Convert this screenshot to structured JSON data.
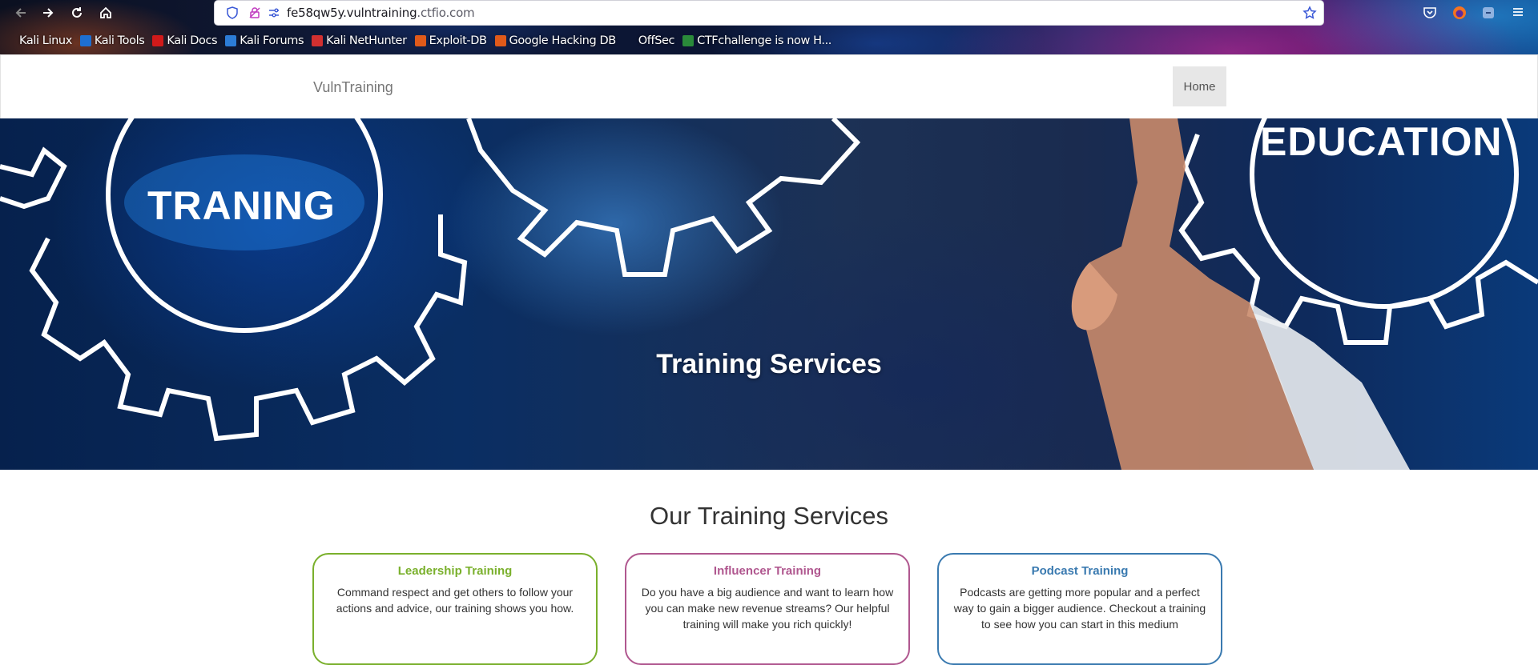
{
  "browser": {
    "url_host": "fe58qw5y.vulntraining",
    "url_tld": ".ctfio.com",
    "bookmarks": [
      {
        "label": "Kali Linux",
        "color": ""
      },
      {
        "label": "Kali Tools",
        "color": "#1e6fd1"
      },
      {
        "label": "Kali Docs",
        "color": "#d11a1a"
      },
      {
        "label": "Kali Forums",
        "color": "#2c7cd6"
      },
      {
        "label": "Kali NetHunter",
        "color": "#d23030"
      },
      {
        "label": "Exploit-DB",
        "color": "#e05a1a"
      },
      {
        "label": "Google Hacking DB",
        "color": "#e05a1a"
      },
      {
        "label": "OffSec",
        "color": ""
      },
      {
        "label": "CTFchallenge is now H...",
        "color": "#2a8a3a"
      }
    ],
    "icons": [
      "back-arrow-icon",
      "forward-arrow-icon",
      "reload-icon",
      "home-icon",
      "shield-icon",
      "permissions-icon",
      "site-info-icon",
      "bookmark-star-icon",
      "pocket-icon",
      "firefox-account-icon",
      "extensions-icon",
      "menu-icon"
    ]
  },
  "site": {
    "brand": "VulnTraining",
    "nav": {
      "home": "Home"
    }
  },
  "hero": {
    "title": "Training Services",
    "gear_left_text": "TRANING",
    "gear_right_text": "EDUCATION"
  },
  "services": {
    "heading": "Our Training Services",
    "cards": [
      {
        "title": "Leadership Training",
        "text": "Command respect and get others to follow your actions and advice, our training shows you how.",
        "color": "#7ab02c"
      },
      {
        "title": "Influencer Training",
        "text": "Do you have a big audience and want to learn how you can make new revenue streams? Our helpful training will make you rich quickly!",
        "color": "#b0578f"
      },
      {
        "title": "Podcast Training",
        "text": "Podcasts are getting more popular and a perfect way to gain a bigger audience. Checkout a training to see how you can start in this medium",
        "color": "#3a7ab0"
      }
    ]
  }
}
